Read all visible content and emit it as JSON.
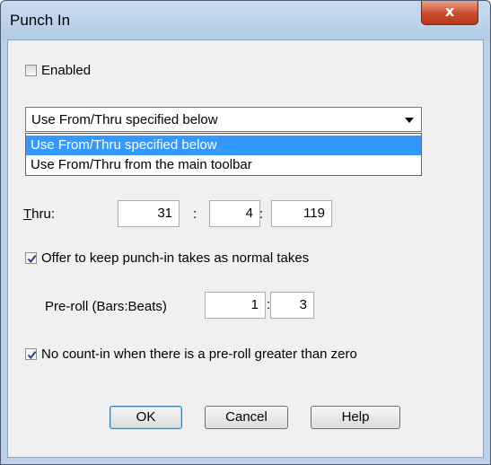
{
  "window": {
    "title": "Punch In",
    "close_glyph": "x"
  },
  "enabled": {
    "label": "Enabled",
    "checked": false
  },
  "mode_select": {
    "selected": "Use From/Thru specified below",
    "options": [
      "Use From/Thru specified below",
      "Use From/Thru from the main toolbar"
    ],
    "highlighted_index": 0
  },
  "thru": {
    "label_first": "T",
    "label_rest": "hru:",
    "bar": "31",
    "beat": "4",
    "tick": "119",
    "sep1": ":",
    "sep2": ":"
  },
  "offer_keep": {
    "label": "Offer to keep punch-in takes as normal takes",
    "checked": true
  },
  "preroll": {
    "label": "Pre-roll (Bars:Beats)",
    "bars": "1",
    "beats": "3",
    "sep": ":"
  },
  "no_count_in": {
    "label": "No count-in when there is a pre-roll greater than zero",
    "checked": true
  },
  "buttons": {
    "ok": "OK",
    "cancel": "Cancel",
    "help": "Help"
  },
  "colors": {
    "selection": "#3399ff",
    "titlebar": "#bcd2ea",
    "close": "#c74b2c"
  }
}
